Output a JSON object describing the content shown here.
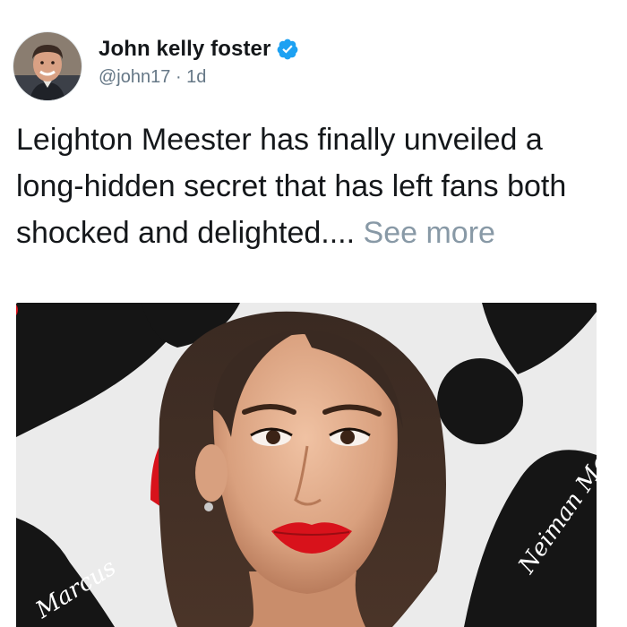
{
  "author": {
    "display_name": "John kelly foster",
    "handle": "@john17",
    "separator": "·",
    "time_ago": "1d",
    "verified": true
  },
  "tweet": {
    "text": "Leighton Meester has finally unveiled a long-hidden secret that has left fans both shocked and delighted....",
    "see_more_label": "See more"
  },
  "media": {
    "backdrop_text_left": "Marcus",
    "backdrop_text_right": "Neiman Marcus"
  },
  "colors": {
    "verified_blue": "#1da1f2",
    "see_more_grey": "#8899a6",
    "handle_grey": "#657786",
    "lip_red": "#d8121b"
  },
  "icons": {
    "verified": "verified-badge-icon"
  }
}
